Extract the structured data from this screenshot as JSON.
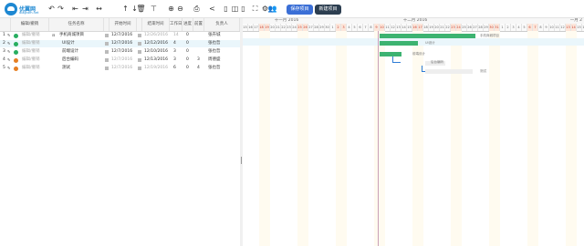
{
  "logo": {
    "name": "优翼网",
    "sub": "diagram.net"
  },
  "toolbar": {
    "icons": [
      {
        "name": "undo-icon",
        "glyph": "↶"
      },
      {
        "name": "redo-icon",
        "glyph": "↷"
      },
      {
        "name": "outdent-icon",
        "glyph": "⇤"
      },
      {
        "name": "indent-icon",
        "glyph": "⇥"
      },
      {
        "name": "move-horizontal-icon",
        "glyph": "↔"
      },
      {
        "name": "move-up-icon",
        "glyph": "↑"
      },
      {
        "name": "move-down-icon",
        "glyph": "↓"
      },
      {
        "name": "delete-icon",
        "glyph": "🗑"
      },
      {
        "name": "align-center-icon",
        "glyph": "⊤"
      },
      {
        "name": "zoom-in-icon",
        "glyph": "⊕"
      },
      {
        "name": "zoom-out-icon",
        "glyph": "⊖"
      },
      {
        "name": "print-icon",
        "glyph": "⎙"
      },
      {
        "name": "share-icon",
        "glyph": "<"
      },
      {
        "name": "layout-left-icon",
        "glyph": "▯"
      },
      {
        "name": "layout-split-icon",
        "glyph": "◫"
      },
      {
        "name": "layout-right-icon",
        "glyph": "▯"
      },
      {
        "name": "fullscreen-icon",
        "glyph": "⛶"
      },
      {
        "name": "settings-icon",
        "glyph": "⚙"
      },
      {
        "name": "users-icon",
        "glyph": "👥"
      }
    ],
    "save_label": "保存项目",
    "new_label": "新建项目"
  },
  "grid": {
    "headers": [
      "",
      "编辑/撤销",
      "任务名称",
      "",
      "开始时间",
      "",
      "结束时间",
      "工作日",
      "进度",
      "前置",
      "负责人"
    ],
    "rows": [
      {
        "num": "1",
        "action": "编辑/撤销",
        "name": "手机商城项目",
        "start": "12/7/2016",
        "end": "12/26/2016",
        "days": "14",
        "progress": "0",
        "pre": "",
        "owner": "张卉城",
        "color": "#27ae60",
        "end_grey": true,
        "days_grey": true
      },
      {
        "num": "2",
        "action": "编辑/撤销",
        "name": "UI设计",
        "start": "12/7/2016",
        "end": "12/12/2016",
        "days": "4",
        "progress": "0",
        "pre": "",
        "owner": "张也哲",
        "color": "#27ae60",
        "selected": true
      },
      {
        "num": "3",
        "action": "编辑/撤销",
        "name": "前端设计",
        "start": "12/7/2016",
        "end": "12/10/2016",
        "days": "3",
        "progress": "0",
        "pre": "",
        "owner": "张也哲",
        "color": "#27ae60"
      },
      {
        "num": "4",
        "action": "编辑/撤销",
        "name": "后台编码",
        "start": "12/7/2016",
        "end": "12/13/2016",
        "days": "3",
        "progress": "0",
        "pre": "3",
        "owner": "周德盛",
        "color": "#e67e22",
        "start_grey": true
      },
      {
        "num": "5",
        "action": "编辑/撤销",
        "name": "测试",
        "start": "12/7/2016",
        "end": "12/19/2016",
        "days": "6",
        "progress": "0",
        "pre": "4",
        "owner": "张也哲",
        "color": "#e67e22",
        "start_grey": true,
        "end_grey": true
      }
    ]
  },
  "gantt": {
    "months": [
      "十一月 2016",
      "十二月 2016",
      "一月 2"
    ],
    "days": [
      "15",
      "16",
      "17",
      "18",
      "19",
      "20",
      "21",
      "22",
      "23",
      "24",
      "25",
      "26",
      "27",
      "28",
      "29",
      "30",
      "1",
      "2",
      "3",
      "4",
      "5",
      "6",
      "7",
      "8",
      "9",
      "10",
      "11",
      "12",
      "13",
      "14",
      "15",
      "16",
      "17",
      "18",
      "19",
      "20",
      "21",
      "22",
      "23",
      "24",
      "25",
      "26",
      "27",
      "28",
      "29",
      "30",
      "31",
      "1",
      "2",
      "3",
      "4",
      "5",
      "6",
      "7",
      "8",
      "9",
      "10",
      "11",
      "12",
      "13",
      "14",
      "15",
      "16"
    ],
    "weekend_days": [
      3,
      4,
      10,
      11,
      17,
      18,
      24,
      25,
      31,
      32,
      38,
      39,
      45,
      46,
      52,
      53,
      59,
      60
    ],
    "bar_labels": [
      "手机商城项目",
      "UI设计",
      "前端设计",
      "后台编码",
      "测试"
    ]
  }
}
